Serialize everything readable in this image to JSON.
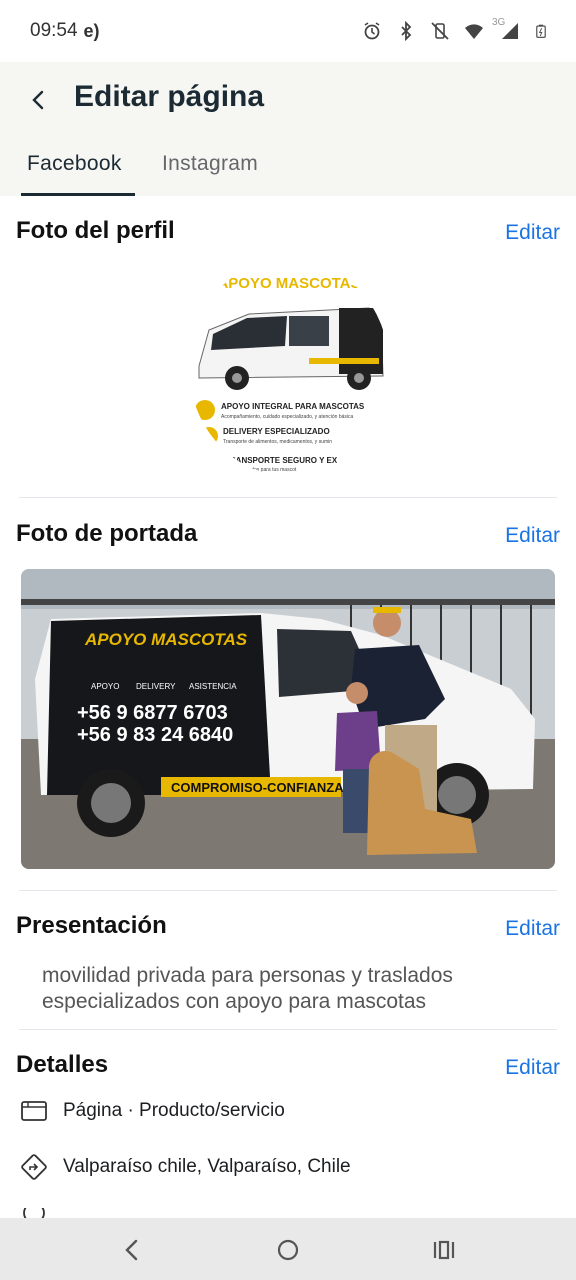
{
  "status": {
    "time": "09:54",
    "network": "3G"
  },
  "header": {
    "title": "Editar página"
  },
  "tabs": [
    {
      "label": "Facebook"
    },
    {
      "label": "Instagram"
    }
  ],
  "profile": {
    "title": "Foto del perfil",
    "edit": "Editar",
    "image_text": {
      "headline": "APOYO MASCOTAS",
      "item1_title": "APOYO INTEGRAL PARA MASCOTAS",
      "item1_sub": "Acompañamiento, cuidado especializado, y atención básica",
      "item2_title": "DELIVERY ESPECIALIZADO",
      "item2_sub": "Transporte de alimentos, medicamentos, y sumin",
      "item3_title": "TRANSPORTE SEGURO Y EX",
      "item3_sub": "cómodos para tus mascot"
    }
  },
  "cover": {
    "title": "Foto de portada",
    "edit": "Editar",
    "image_text": {
      "brand": "APOYO MASCOTAS",
      "label1": "APOYO",
      "label2": "DELIVERY",
      "label3": "ASISTENCIA",
      "phone1": "+56 9 6877 6703",
      "phone2": "+56 9 83 24 6840",
      "slogan": "COMPROMISO-CONFIANZA-AMOR"
    }
  },
  "presentation": {
    "title": "Presentación",
    "edit": "Editar",
    "text": "movilidad privada para personas y traslados especializados con apoyo para mascotas"
  },
  "details": {
    "title": "Detalles",
    "edit": "Editar",
    "items": [
      {
        "icon": "page-icon",
        "text": "Página · Producto/servicio"
      },
      {
        "icon": "directions-icon",
        "text": "Valparaíso chile, Valparaíso, Chile"
      }
    ]
  },
  "colors": {
    "accent": "#1b74e4",
    "header_bg": "#f6f6f3",
    "navbar_bg": "#e9e9e9"
  }
}
